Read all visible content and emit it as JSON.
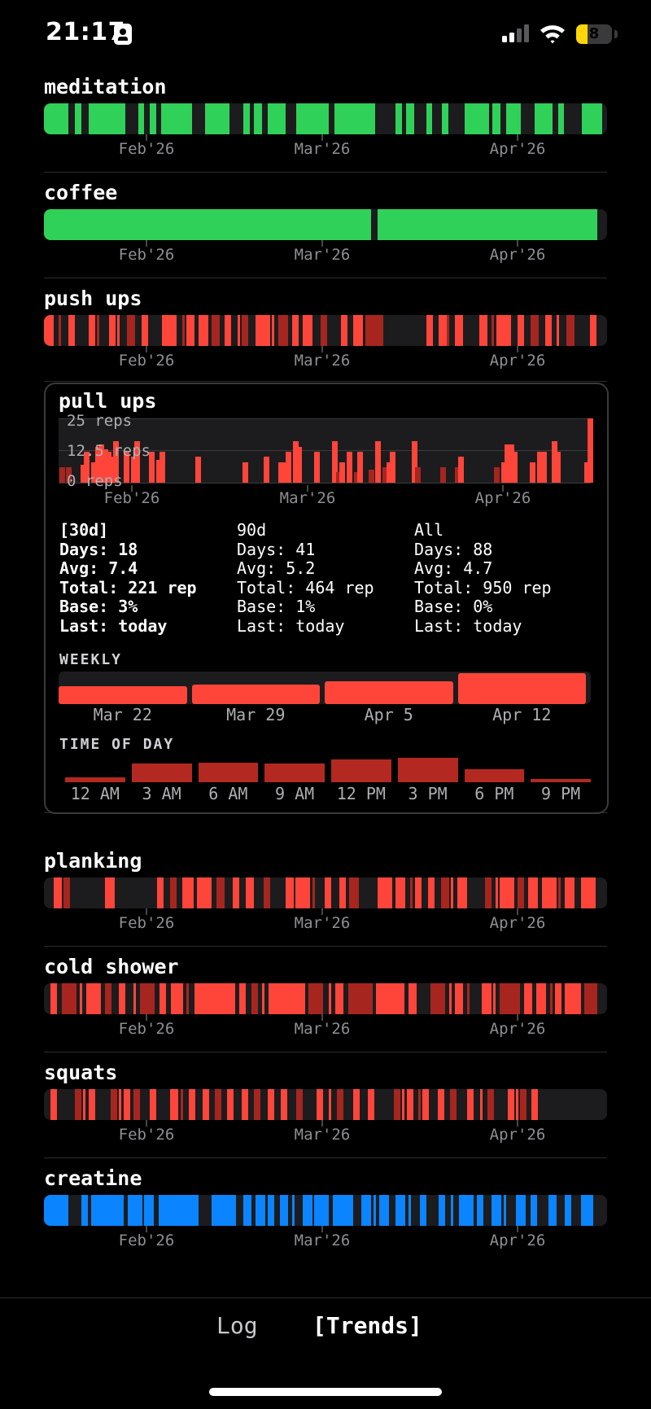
{
  "status_bar": {
    "time": "21:17",
    "battery": "8"
  },
  "colors": {
    "green": "#30d158",
    "red": "#ff453a",
    "dark_red": "#a6261f",
    "blue": "#0a84ff",
    "track": "#1c1c1e"
  },
  "habits": [
    {
      "name": "meditation",
      "color": "green",
      "months": [
        "Feb'26",
        "Mar'26",
        "Apr'26"
      ]
    },
    {
      "name": "coffee",
      "color": "green",
      "months": [
        "Feb'26",
        "Mar'26",
        "Apr'26"
      ]
    },
    {
      "name": "push ups",
      "color": "red",
      "months": [
        "Feb'26",
        "Mar'26",
        "Apr'26"
      ]
    },
    {
      "name": "planking",
      "color": "red",
      "months": [
        "Feb'26",
        "Mar'26",
        "Apr'26"
      ]
    },
    {
      "name": "cold shower",
      "color": "red",
      "months": [
        "Feb'26",
        "Mar'26",
        "Apr'26"
      ]
    },
    {
      "name": "squats",
      "color": "red",
      "months": [
        "Feb'26",
        "Mar'26",
        "Apr'26"
      ]
    },
    {
      "name": "creatine",
      "color": "blue",
      "months": [
        "Feb'26",
        "Mar'26",
        "Apr'26"
      ]
    }
  ],
  "pull_ups": {
    "name": "pull ups",
    "chart_data": {
      "type": "bar",
      "ylabels": [
        "25 reps",
        "12.5 reps",
        "0 reps"
      ],
      "ylim": [
        0,
        25
      ],
      "xlabels": [
        "Feb'26",
        "Mar'26",
        "Apr'26"
      ],
      "values": [
        6,
        0,
        6,
        0,
        0,
        0,
        7,
        12,
        0,
        8,
        14,
        15,
        13,
        12,
        10,
        16,
        0,
        0,
        12,
        0,
        10,
        16,
        0,
        0,
        0,
        12,
        0,
        9,
        12,
        0,
        0,
        0,
        0,
        0,
        0,
        0,
        0,
        0,
        10,
        0,
        0,
        0,
        0,
        0,
        0,
        0,
        0,
        0,
        0,
        0,
        0,
        8,
        0,
        0,
        0,
        0,
        0,
        10,
        0,
        0,
        0,
        8,
        8,
        12,
        0,
        16,
        14,
        0,
        0,
        0,
        0,
        12,
        0,
        0,
        0,
        0,
        16,
        4,
        8,
        0,
        12,
        0,
        4,
        12,
        0,
        0,
        5,
        0,
        16,
        0,
        6,
        8,
        12,
        0,
        0,
        0,
        0,
        0,
        16,
        6,
        0,
        0,
        0,
        0,
        0,
        0,
        6,
        0,
        0,
        0,
        6,
        10,
        0,
        0,
        0,
        0,
        0,
        0,
        0,
        0,
        0,
        6,
        0,
        8,
        15,
        15,
        12,
        0,
        0,
        0,
        0,
        8,
        0,
        12,
        12,
        0,
        0,
        16,
        12,
        0,
        0,
        0,
        0,
        0,
        0,
        0,
        8,
        25
      ]
    },
    "stats": {
      "labels": [
        "Days:",
        "Avg:",
        "Total:",
        "Base:",
        "Last:"
      ],
      "columns": [
        {
          "title": "[30d]",
          "values": [
            "18",
            "7.4",
            "221 rep",
            "3%",
            "today"
          ]
        },
        {
          "title": "90d",
          "values": [
            "41",
            "5.2",
            "464 rep",
            "1%",
            "today"
          ]
        },
        {
          "title": "All",
          "values": [
            "88",
            "4.7",
            "950 rep",
            "0%",
            "today"
          ]
        }
      ]
    },
    "weekly": {
      "title": "WEEKLY",
      "chart_data": {
        "type": "bar",
        "categories": [
          "Mar 22",
          "Mar 29",
          "Apr 5",
          "Apr 12"
        ],
        "values": [
          0.55,
          0.6,
          0.7,
          0.95
        ]
      }
    },
    "time_of_day": {
      "title": "TIME OF DAY",
      "chart_data": {
        "type": "bar",
        "categories": [
          "12 AM",
          "3 AM",
          "6 AM",
          "9 AM",
          "12 PM",
          "3 PM",
          "6 PM",
          "9 PM"
        ],
        "values": [
          0.2,
          0.72,
          0.74,
          0.72,
          0.88,
          0.95,
          0.5,
          0.12
        ]
      }
    }
  },
  "tabs": {
    "log": "Log",
    "trends": "[Trends]"
  }
}
